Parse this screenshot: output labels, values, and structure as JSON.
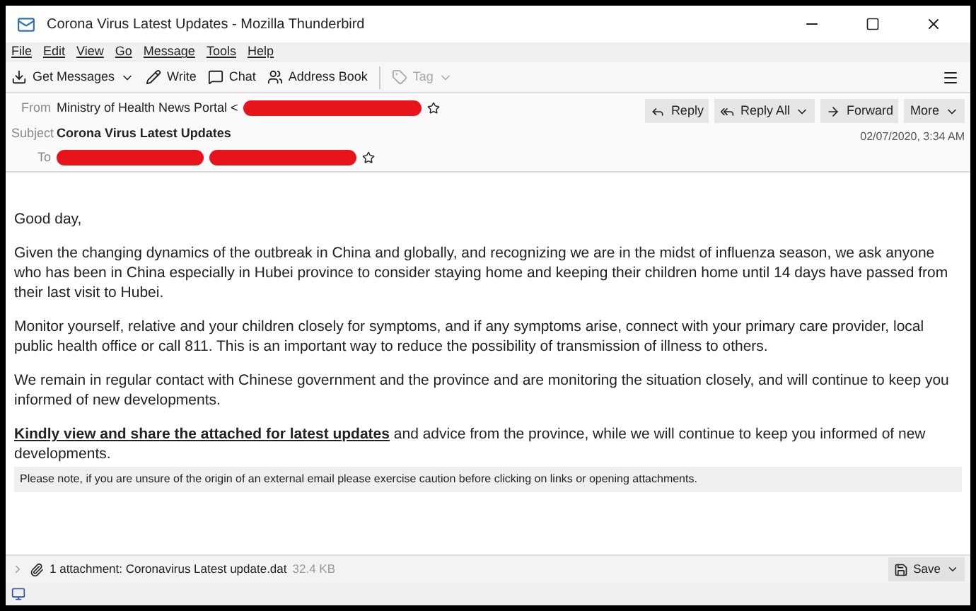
{
  "window": {
    "title": "Corona Virus Latest Updates - Mozilla Thunderbird"
  },
  "menu": [
    "File",
    "Edit",
    "View",
    "Go",
    "Message",
    "Tools",
    "Help"
  ],
  "toolbar": [
    {
      "kind": "get",
      "label": "Get Messages",
      "disabled": false
    },
    {
      "kind": "write",
      "label": "Write",
      "disabled": false
    },
    {
      "kind": "chat",
      "label": "Chat",
      "disabled": false
    },
    {
      "kind": "address",
      "label": "Address Book",
      "disabled": false
    },
    {
      "kind": "tag",
      "label": "Tag",
      "disabled": true
    }
  ],
  "header": {
    "from_label": "From",
    "from": "Ministry of Health News Portal <",
    "subject_label": "Subject",
    "subject": "Corona Virus Latest Updates",
    "to_label": "To",
    "date": "02/07/2020, 3:34 AM",
    "actions": [
      {
        "kind": "reply",
        "label": "Reply"
      },
      {
        "kind": "replyall",
        "label": "Reply All"
      },
      {
        "kind": "forward",
        "label": "Forward"
      },
      {
        "kind": "more",
        "label": "More"
      }
    ]
  },
  "body": [
    "Good day,",
    "Given the changing dynamics of the outbreak in China and globally, and recognizing we are in the midst of influenza season, we ask anyone who has been in China especially in Hubei province to consider staying home and keeping their children home until 14 days have passed from their last visit to Hubei.",
    "Monitor yourself, relative and your children closely for symptoms, and if any symptoms arise, connect with your primary care provider, local public health office or call 811. This is an important way to reduce the possibility of transmission of illness to others.",
    "We remain in regular contact with Chinese government and the province and are monitoring the situation closely, and will continue to keep you informed of new developments.",
    "**Kindly view and share the attached for latest updates** and advice from the province, while we will continue to keep you informed of new developments."
  ],
  "notice": "Please note, if you are unsure of the origin of an external email please exercise caution before clicking on links or opening attachments.",
  "attachment": {
    "label": "1 attachment: Coronavirus Latest update.dat",
    "size": "32.4 KB",
    "save": "Save"
  }
}
